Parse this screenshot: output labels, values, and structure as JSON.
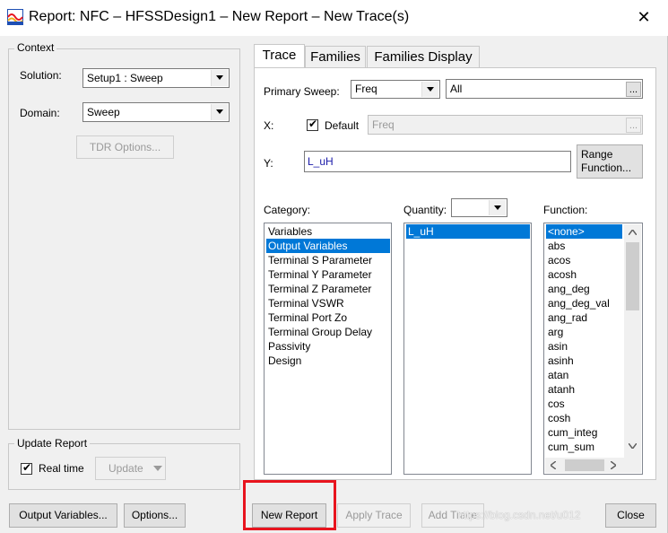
{
  "window": {
    "title": "Report: NFC – HFSSDesign1 – New Report – New Trace(s)",
    "close": "✕"
  },
  "context": {
    "group_label": "Context",
    "solution_label": "Solution:",
    "solution_value": "Setup1 : Sweep",
    "domain_label": "Domain:",
    "domain_value": "Sweep",
    "tdr_button": "TDR Options..."
  },
  "update_report": {
    "group_label": "Update Report",
    "realtime_label": "Real time",
    "update_button": "Update"
  },
  "tabs": [
    "Trace",
    "Families",
    "Families Display"
  ],
  "trace": {
    "primary_sweep_label": "Primary Sweep:",
    "primary_sweep_value": "Freq",
    "primary_sweep_range": "All",
    "x_label": "X:",
    "default_label": "Default",
    "x_value": "Freq",
    "y_label": "Y:",
    "y_value": "L_uH",
    "range_function_button": [
      "Range",
      "Function..."
    ],
    "category_label": "Category:",
    "quantity_label": "Quantity:",
    "function_label": "Function:",
    "categories": [
      "Variables",
      "Output Variables",
      "Terminal S Parameter",
      "Terminal Y Parameter",
      "Terminal Z Parameter",
      "Terminal VSWR",
      "Terminal Port Zo",
      "Terminal Group Delay",
      "Passivity",
      "Design"
    ],
    "category_selected": 1,
    "quantities": [
      "L_uH"
    ],
    "functions": [
      "<none>",
      "abs",
      "acos",
      "acosh",
      "ang_deg",
      "ang_deg_val",
      "ang_rad",
      "arg",
      "asin",
      "asinh",
      "atan",
      "atanh",
      "cos",
      "cosh",
      "cum_integ",
      "cum_sum"
    ],
    "ellipsis": "..."
  },
  "buttons": {
    "output_variables": "Output Variables...",
    "options": "Options...",
    "new_report": "New Report",
    "apply_trace": "Apply Trace",
    "add_trace": "Add Trace",
    "close": "Close"
  },
  "watermark": "https://blog.csdn.net/u012"
}
